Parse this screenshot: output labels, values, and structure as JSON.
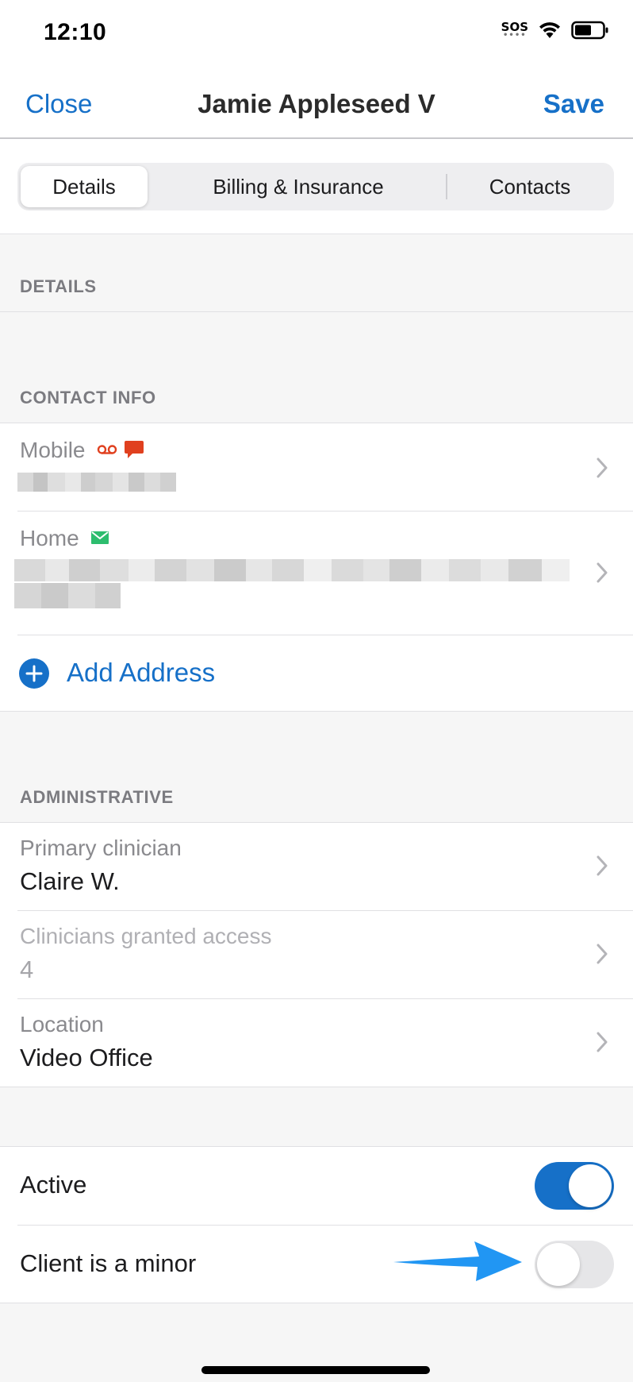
{
  "status_bar": {
    "time": "12:10",
    "sos": "SOS"
  },
  "nav": {
    "close_label": "Close",
    "title": "Jamie Appleseed V",
    "save_label": "Save"
  },
  "segments": [
    {
      "label": "Details",
      "selected": true
    },
    {
      "label": "Billing & Insurance",
      "selected": false
    },
    {
      "label": "Contacts",
      "selected": false
    }
  ],
  "sections": {
    "details": "DETAILS",
    "contact_info": "CONTACT INFO",
    "administrative": "ADMINISTRATIVE"
  },
  "contact_info": {
    "mobile_label": "Mobile",
    "home_label": "Home",
    "add_address_label": "Add Address"
  },
  "administrative": {
    "primary_clinician_label": "Primary clinician",
    "primary_clinician_value": "Claire W.",
    "clinicians_access_label": "Clinicians granted access",
    "clinicians_access_value": "4",
    "location_label": "Location",
    "location_value": "Video Office"
  },
  "toggles": {
    "active_label": "Active",
    "active_on": true,
    "minor_label": "Client is a minor",
    "minor_on": false
  },
  "colors": {
    "accent": "#1670c8",
    "voicemail_icon": "#e0401f",
    "sms_icon": "#e0401f",
    "email_icon": "#2dbd6e",
    "annotation_arrow": "#2196f3"
  }
}
